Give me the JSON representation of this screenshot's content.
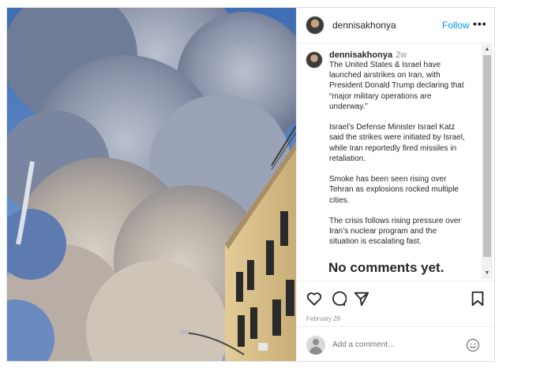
{
  "header": {
    "username": "dennisakhonya",
    "follow_label": "Follow",
    "more_label": "•••"
  },
  "caption": {
    "username": "dennisakhonya",
    "time": "2w",
    "paragraphs": [
      "The United States & Israel have\nlaunched airstrikes on Iran, with\nPresident Donald Trump declaring that\n“major military operations are\nunderway.”",
      "Israel’s Defense Minister Israel Katz\nsaid the strikes were initiated by Israel,\nwhile Iran reportedly fired missiles in\nretaliation.",
      "Smoke has been seen rising over\nTehran as explosions rocked multiple\ncities.",
      "The crisis follows rising pressure over\nIran’s nuclear program  and the\nsituation is escalating fast."
    ]
  },
  "comments": {
    "empty_label": "No comments yet."
  },
  "actions": {
    "like_icon": "heart-icon",
    "comment_icon": "comment-icon",
    "share_icon": "share-icon",
    "save_icon": "bookmark-icon",
    "date": "February 28"
  },
  "add_comment": {
    "placeholder": "Add a comment...",
    "emoji_icon": "emoji-icon"
  },
  "colors": {
    "link_blue": "#0095f6",
    "text": "#262626",
    "muted": "#8e8e8e",
    "border": "#dbdbdb"
  }
}
